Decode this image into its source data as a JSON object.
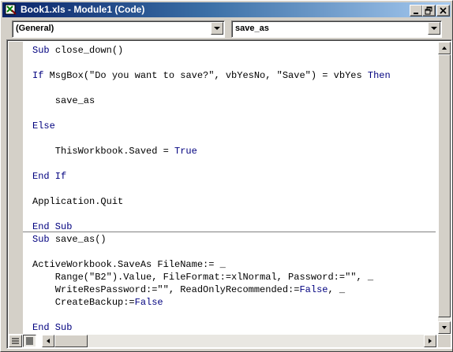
{
  "window": {
    "title": "Book1.xls - Module1 (Code)"
  },
  "title_buttons": {
    "minimize": "minimize-icon",
    "restore": "restore-icon",
    "close": "close-icon"
  },
  "object_combo": {
    "value": "(General)"
  },
  "procedure_combo": {
    "value": "save_as"
  },
  "code_lines": [
    [
      {
        "t": "Sub ",
        "k": 1
      },
      {
        "t": "close_down()"
      }
    ],
    [],
    [
      {
        "t": "If ",
        "k": 1
      },
      {
        "t": "MsgBox(\"Do you want to save?\", vbYesNo, \"Save\") = vbYes "
      },
      {
        "t": "Then",
        "k": 1
      }
    ],
    [],
    [
      {
        "t": "    save_as"
      }
    ],
    [],
    [
      {
        "t": "Else",
        "k": 1
      }
    ],
    [],
    [
      {
        "t": "    ThisWorkbook.Saved = "
      },
      {
        "t": "True",
        "k": 1
      }
    ],
    [],
    [
      {
        "t": "End If",
        "k": 1
      }
    ],
    [],
    [
      {
        "t": "Application.Quit"
      }
    ],
    [],
    [
      {
        "t": "End Sub",
        "k": 1
      }
    ],
    [
      {
        "t": "Sub ",
        "k": 1
      },
      {
        "t": "save_as()"
      }
    ],
    [],
    [
      {
        "t": "ActiveWorkbook.SaveAs FileName:= _"
      }
    ],
    [
      {
        "t": "    Range(\"B2\").Value, FileFormat:=xlNormal, Password:=\"\", _"
      }
    ],
    [
      {
        "t": "    WriteResPassword:=\"\", ReadOnlyRecommended:="
      },
      {
        "t": "False",
        "k": 1
      },
      {
        "t": ", _"
      }
    ],
    [
      {
        "t": "    CreateBackup:="
      },
      {
        "t": "False",
        "k": 1
      }
    ],
    [],
    [
      {
        "t": "End Sub",
        "k": 1
      }
    ]
  ],
  "colors": {
    "keyword": "#00007f",
    "text": "#000000",
    "titlebar_start": "#0a246a",
    "titlebar_end": "#a6caf0"
  }
}
